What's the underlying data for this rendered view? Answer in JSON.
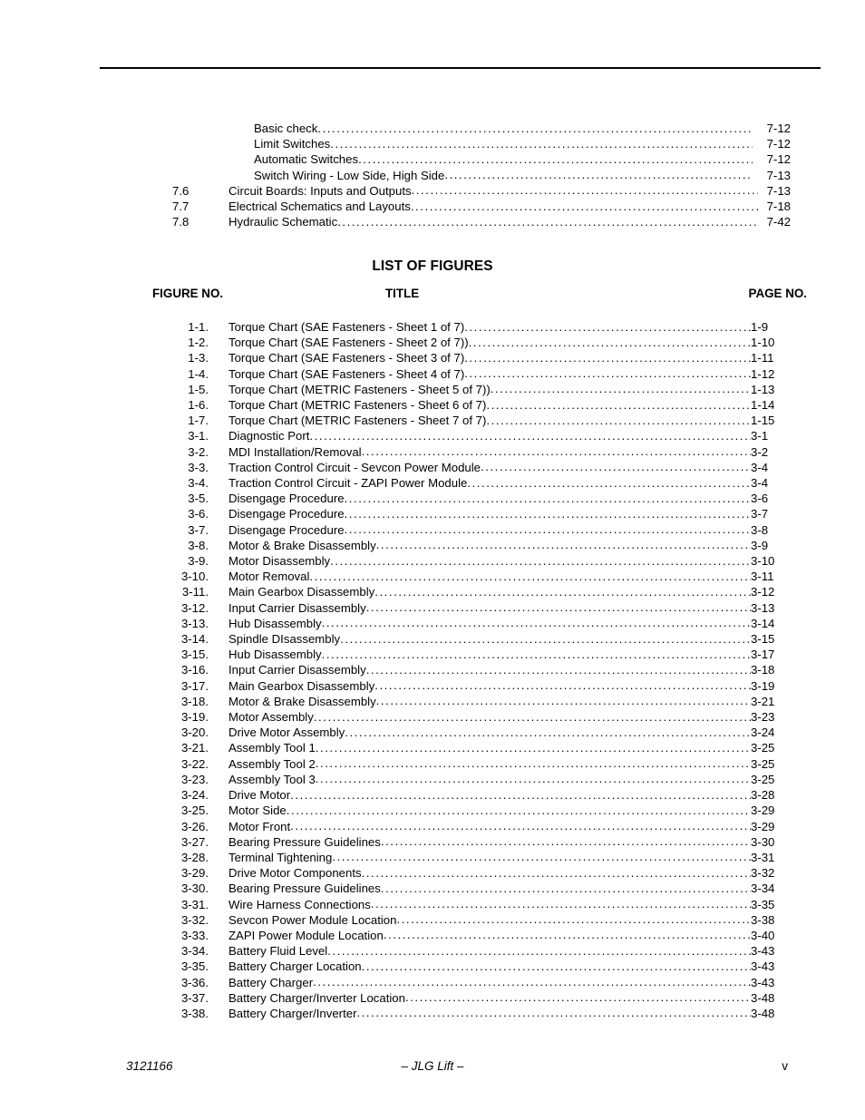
{
  "document": {
    "footer_left": "3121166",
    "footer_center": "– JLG Lift –",
    "footer_right": "v"
  },
  "toc": {
    "entries": [
      {
        "number": "",
        "title": "Basic check",
        "page": "7-12",
        "level": "sub"
      },
      {
        "number": "",
        "title": "Limit Switches",
        "page": "7-12",
        "level": "sub"
      },
      {
        "number": "",
        "title": "Automatic Switches",
        "page": "7-12",
        "level": "sub"
      },
      {
        "number": "",
        "title": "Switch Wiring - Low Side, High Side",
        "page": "7-13",
        "level": "sub"
      },
      {
        "number": "7.6",
        "title": "Circuit Boards:  Inputs and Outputs",
        "page": "7-13",
        "level": "main"
      },
      {
        "number": "7.7",
        "title": "Electrical Schematics and Layouts",
        "page": "7-18",
        "level": "main"
      },
      {
        "number": "7.8",
        "title": "Hydraulic Schematic",
        "page": "7-42",
        "level": "main"
      }
    ]
  },
  "list_of_figures": {
    "heading": "LIST OF FIGURES",
    "columns": {
      "figure_no": "FIGURE NO.",
      "title": "TITLE",
      "page_no": "PAGE NO."
    },
    "entries": [
      {
        "number": "1-1.",
        "title": "Torque Chart (SAE Fasteners - Sheet 1 of 7)",
        "page": "1-9"
      },
      {
        "number": "1-2.",
        "title": "Torque Chart (SAE Fasteners - Sheet 2 of 7))",
        "page": "1-10"
      },
      {
        "number": "1-3.",
        "title": "Torque Chart (SAE Fasteners - Sheet 3 of 7)",
        "page": "1-11"
      },
      {
        "number": "1-4.",
        "title": "Torque Chart (SAE Fasteners - Sheet 4 of 7)",
        "page": "1-12"
      },
      {
        "number": "1-5.",
        "title": "Torque Chart (METRIC Fasteners - Sheet 5 of 7))",
        "page": "1-13"
      },
      {
        "number": "1-6.",
        "title": "Torque Chart (METRIC Fasteners - Sheet 6 of 7)",
        "page": "1-14"
      },
      {
        "number": "1-7.",
        "title": "Torque Chart (METRIC Fasteners - Sheet 7 of 7)",
        "page": "1-15"
      },
      {
        "number": "3-1.",
        "title": "Diagnostic Port",
        "page": "3-1"
      },
      {
        "number": "3-2.",
        "title": "MDI Installation/Removal",
        "page": "3-2"
      },
      {
        "number": "3-3.",
        "title": "Traction Control Circuit - Sevcon Power Module",
        "page": "3-4"
      },
      {
        "number": "3-4.",
        "title": "Traction Control Circuit - ZAPI Power Module",
        "page": "3-4"
      },
      {
        "number": "3-5.",
        "title": "Disengage Procedure",
        "page": "3-6"
      },
      {
        "number": "3-6.",
        "title": "Disengage Procedure",
        "page": "3-7"
      },
      {
        "number": "3-7.",
        "title": "Disengage Procedure",
        "page": "3-8"
      },
      {
        "number": "3-8.",
        "title": "Motor & Brake Disassembly",
        "page": "3-9"
      },
      {
        "number": "3-9.",
        "title": "Motor Disassembly",
        "page": "3-10"
      },
      {
        "number": "3-10.",
        "title": "Motor Removal",
        "page": "3-11"
      },
      {
        "number": "3-11.",
        "title": "Main Gearbox Disassembly",
        "page": "3-12"
      },
      {
        "number": "3-12.",
        "title": "Input Carrier Disassembly",
        "page": "3-13"
      },
      {
        "number": "3-13.",
        "title": "Hub Disassembly",
        "page": "3-14"
      },
      {
        "number": "3-14.",
        "title": "Spindle DIsassembly",
        "page": "3-15"
      },
      {
        "number": "3-15.",
        "title": "Hub Disassembly",
        "page": "3-17"
      },
      {
        "number": "3-16.",
        "title": "Input Carrier Disassembly",
        "page": "3-18"
      },
      {
        "number": "3-17.",
        "title": "Main Gearbox Disassembly",
        "page": "3-19"
      },
      {
        "number": "3-18.",
        "title": "Motor & Brake Disassembly",
        "page": "3-21"
      },
      {
        "number": "3-19.",
        "title": "Motor Assembly",
        "page": "3-23"
      },
      {
        "number": "3-20.",
        "title": "Drive Motor Assembly",
        "page": "3-24"
      },
      {
        "number": "3-21.",
        "title": "Assembly Tool 1",
        "page": "3-25"
      },
      {
        "number": "3-22.",
        "title": "Assembly Tool 2",
        "page": "3-25"
      },
      {
        "number": "3-23.",
        "title": "Assembly Tool 3",
        "page": "3-25"
      },
      {
        "number": "3-24.",
        "title": "Drive Motor",
        "page": "3-28"
      },
      {
        "number": "3-25.",
        "title": "Motor Side",
        "page": "3-29"
      },
      {
        "number": "3-26.",
        "title": "Motor Front",
        "page": "3-29"
      },
      {
        "number": "3-27.",
        "title": "Bearing Pressure Guidelines",
        "page": "3-30"
      },
      {
        "number": "3-28.",
        "title": "Terminal Tightening",
        "page": "3-31"
      },
      {
        "number": "3-29.",
        "title": "Drive Motor Components",
        "page": "3-32"
      },
      {
        "number": "3-30.",
        "title": "Bearing Pressure Guidelines",
        "page": "3-34"
      },
      {
        "number": "3-31.",
        "title": "Wire Harness Connections",
        "page": "3-35"
      },
      {
        "number": "3-32.",
        "title": "Sevcon Power Module Location",
        "page": "3-38"
      },
      {
        "number": "3-33.",
        "title": "ZAPI Power Module Location",
        "page": "3-40"
      },
      {
        "number": "3-34.",
        "title": "Battery Fluid Level",
        "page": "3-43"
      },
      {
        "number": "3-35.",
        "title": "Battery Charger Location",
        "page": "3-43"
      },
      {
        "number": "3-36.",
        "title": "Battery Charger",
        "page": "3-43"
      },
      {
        "number": "3-37.",
        "title": "Battery Charger/Inverter Location",
        "page": "3-48"
      },
      {
        "number": "3-38.",
        "title": "Battery Charger/Inverter",
        "page": "3-48"
      }
    ]
  }
}
